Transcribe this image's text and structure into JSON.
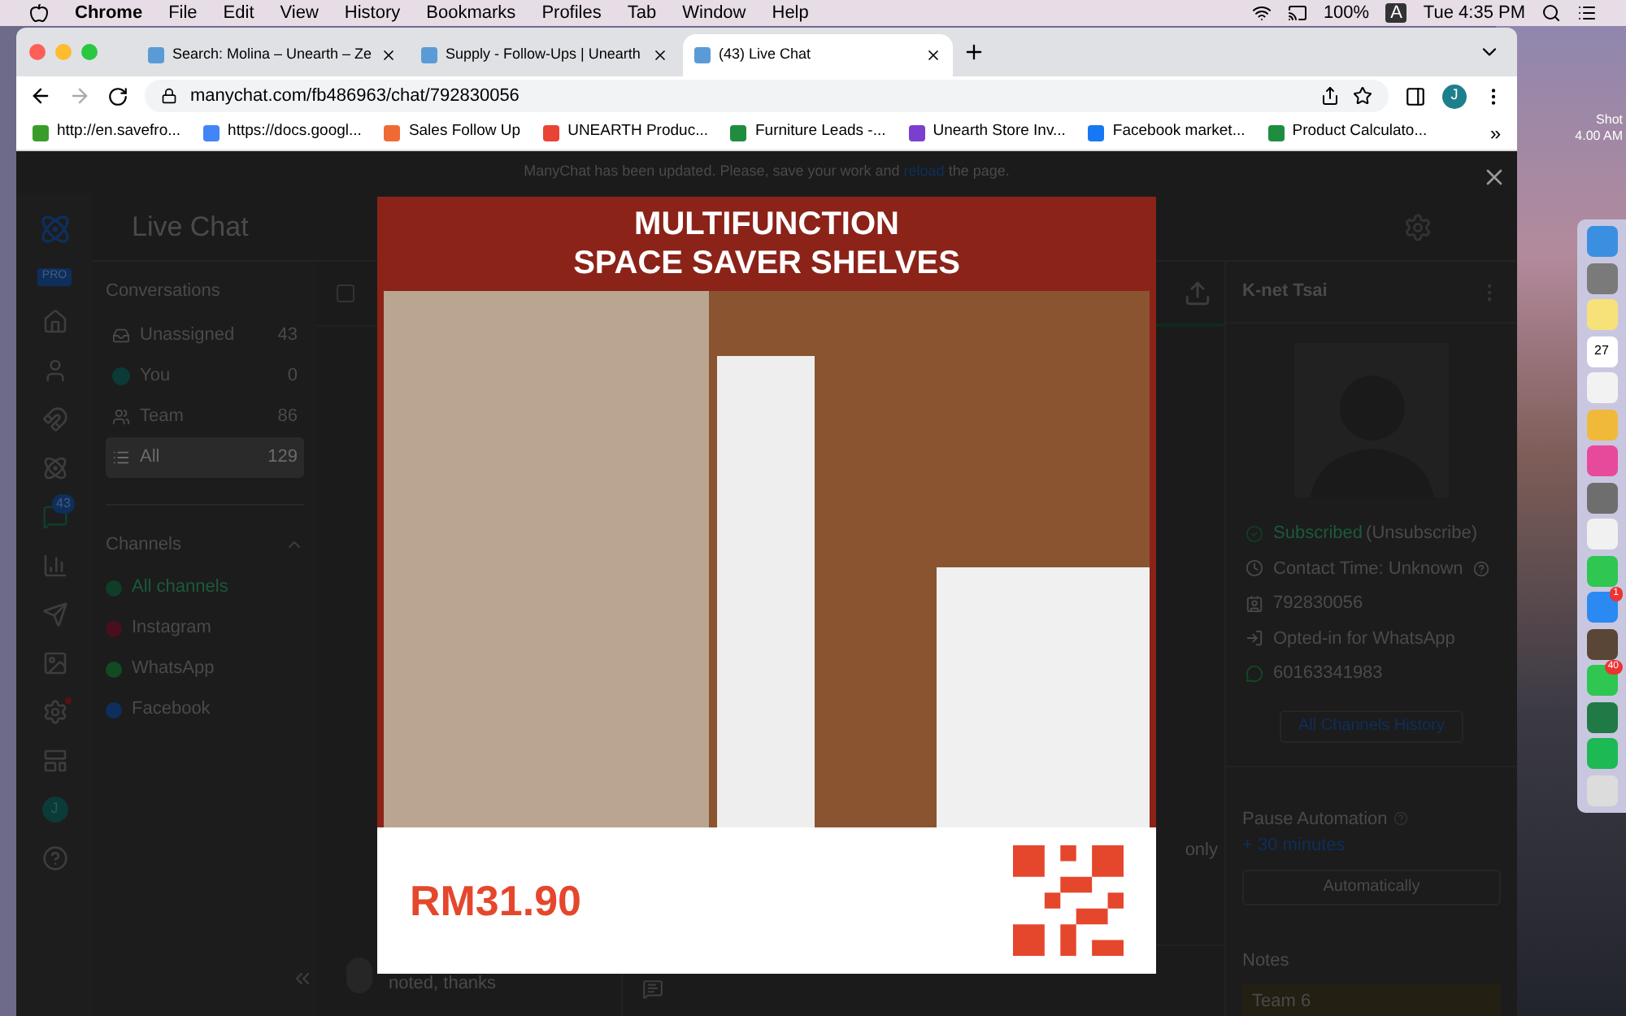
{
  "menu_bar": {
    "app": "Chrome",
    "items": [
      "File",
      "Edit",
      "View",
      "History",
      "Bookmarks",
      "Profiles",
      "Tab",
      "Window",
      "Help"
    ],
    "battery": "100%",
    "input_source": "A",
    "clock": "Tue 4:35 PM"
  },
  "browser": {
    "tabs": [
      {
        "title": "Search: Molina – Unearth – Ze",
        "selected": false
      },
      {
        "title": "Supply - Follow-Ups | Unearth",
        "selected": false
      },
      {
        "title": "(43) Live Chat",
        "selected": true
      }
    ],
    "url": "manychat.com/fb486963/chat/792830056",
    "profile": "J",
    "bookmarks": [
      "http://en.savefro...",
      "https://docs.googl...",
      "Sales Follow Up",
      "UNEARTH Produc...",
      "Furniture Leads -...",
      "Unearth Store Inv...",
      "Facebook market...",
      "Product Calculato..."
    ],
    "more": "»"
  },
  "app": {
    "notice": {
      "before": "ManyChat has been updated. Please, save your work and",
      "link": "reload",
      "after": "the page."
    },
    "rail": {
      "plan_badge": "PRO",
      "chat_badge": "43",
      "avatar": "J"
    },
    "title": "Live Chat",
    "conversations": {
      "heading": "Conversations",
      "items": [
        {
          "label": "Unassigned",
          "count": "43",
          "selected": false
        },
        {
          "label": "You",
          "count": "0",
          "selected": false
        },
        {
          "label": "Team",
          "count": "86",
          "selected": false
        },
        {
          "label": "All",
          "count": "129",
          "selected": true
        }
      ]
    },
    "channels": {
      "heading": "Channels",
      "expanded": true,
      "items": [
        {
          "label": "All channels",
          "selected": true,
          "color": "#0f3d28"
        },
        {
          "label": "Instagram",
          "selected": false,
          "color": "#4a0f1e"
        },
        {
          "label": "WhatsApp",
          "selected": false,
          "color": "#124a22"
        },
        {
          "label": "Facebook",
          "selected": false,
          "color": "#0e2f5c"
        }
      ]
    },
    "select_all_checked": false,
    "chat_preview": "noted, thanks",
    "message_fragment": "only",
    "contact": {
      "name": "K-net Tsai",
      "status": "Subscribed",
      "status_action": "(Unsubscribe)",
      "contact_time": "Contact Time: Unknown",
      "user_id": "792830056",
      "opt_in": "Opted-in for WhatsApp",
      "phone": "60163341983",
      "history_button": "All Channels History",
      "pause_heading": "Pause Automation",
      "pause_add": "+ 30 minutes",
      "pause_button": "Automatically",
      "notes_heading": "Notes",
      "note": "Team 6"
    },
    "viewer": {
      "title_lines": [
        "MULTIFUNCTION",
        "SPACE SAVER SHELVES"
      ],
      "price": "RM31.90"
    }
  },
  "desktop": {
    "file_label": [
      "Shot",
      "4.00 AM"
    ],
    "calendar_day": "27",
    "badges": [
      "1",
      "40"
    ]
  }
}
